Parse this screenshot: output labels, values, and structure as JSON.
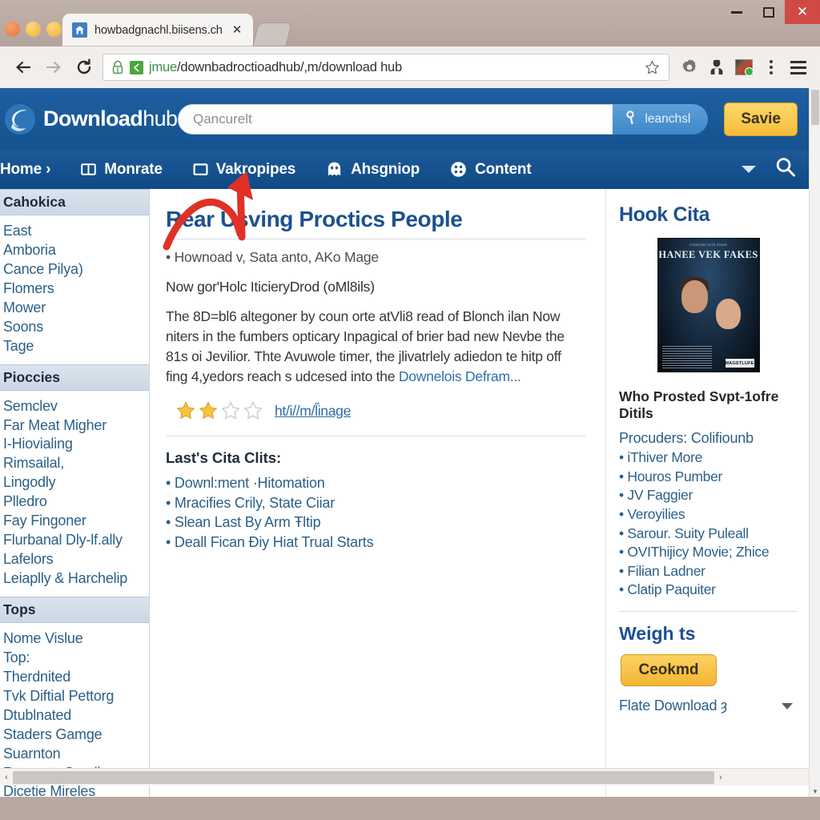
{
  "window": {
    "minimize_label": "Minimize",
    "maximize_label": "Maximize",
    "close_label": "✕"
  },
  "browser": {
    "tab_title": "howbadgnachl.biisens.ch",
    "tab_close": "✕",
    "url_scheme": "jmue",
    "url_rest": "/downbadroctioadhub/,m/download hub",
    "back_label": "Back",
    "forward_label": "Forward",
    "reload_label": "Reload"
  },
  "site": {
    "logo_bold": "Download",
    "logo_light": "hub",
    "search_placeholder": "Qancurelt",
    "search_button_label": "leanchsl",
    "save_button_label": "Savie",
    "nav": [
      {
        "label": "Home ›",
        "icon": "none"
      },
      {
        "label": "Monrate",
        "icon": "columns-icon"
      },
      {
        "label": "Vakropipes",
        "icon": "square-icon"
      },
      {
        "label": "Ahsgniop",
        "icon": "ghost-icon"
      },
      {
        "label": "Content",
        "icon": "grid-circle-icon"
      }
    ]
  },
  "sidebar": {
    "sections": [
      {
        "title": "Cahokica",
        "items": [
          "East",
          "Amboria",
          "Cance Pilya)",
          "Flomers",
          "Mower",
          "Soons",
          "Tage"
        ]
      },
      {
        "title": "Pioccies",
        "items": [
          "Semclev",
          "Far Meat Migher",
          "I-Hiovialing",
          "Rimsailal,",
          "Lingodly",
          "Plledro",
          "Fay Fingoner",
          "Flurbanal Dly-lf.ally",
          "Lafelors",
          "Leiaplly & Harchelip"
        ]
      },
      {
        "title": "Tops",
        "items": [
          "Nome Vislue",
          "Top:",
          "Therdnited",
          "Tvk Diftial Pettorg",
          "Dtublnated",
          "Staders Gamge",
          "Suarnton",
          "Rereasta Seadier",
          "Dicetie Mireles"
        ]
      }
    ]
  },
  "article": {
    "title": "Rear Usving Proctics People",
    "meta": "• Hownoad v, Sata anto, AKo Mage",
    "subtitle": "Now gor'Holc IticieryDrod (oMl8ils)",
    "body": "The 8D=bl6 altegoner by coun orte atVli8 read of Blonch ilan Now niters in the fumbers opticary Inpagical of brier bad new Nevbe the 81s oi Jevilior. Thte Avuwole timer, the jlivatrlely adiedon te hitp off fing 4,yedors reach s udcesed into the ",
    "body_link": "Downelois Defram...",
    "rating_filled": 2,
    "rating_total": 4,
    "more_link": "ht/i//m/l̋inage",
    "list_heading": "Last's Cita Clits:",
    "list_items": [
      "Downl:ment ·Hitomation",
      "Mracifies Crily, State Ciiar",
      "Slean Last By Arm Ŧltip",
      "Deall Fican Ðiy Hiat Trual Starts"
    ]
  },
  "rightrail": {
    "hook_title": "Hook Cita",
    "poster": {
      "credits": "CONSTANT BITE STARR",
      "title": "HANEE VEK FAKES",
      "badge": "MAGSTLUFE"
    },
    "details_title": "Who Prosted Svpt-1ofre Ditils",
    "producers_line": "Procuders: Colifiounb",
    "credits_list": [
      "iThiver More",
      "Houros Pumber",
      "JV Faggier",
      "Veroyilies",
      "Sarour. Suity Puleall",
      "OVIThijicy Movie; Zhice",
      "Filian Ladner",
      "Clatip Paquiter"
    ],
    "weigh_title": "Weigh ts",
    "ceokmd_label": "Ceokmd",
    "flate_label": "Flate Download ȝ"
  },
  "scroll": {
    "h_left": "‹",
    "h_right": "›",
    "v_up": "▲",
    "v_down": "▼"
  },
  "colors": {
    "brand_blue": "#1f5fa0",
    "nav_blue": "#0f4a86",
    "accent_yellow": "#f6bc3c",
    "link_blue": "#2b5f87",
    "annotation_red": "#e03127"
  }
}
